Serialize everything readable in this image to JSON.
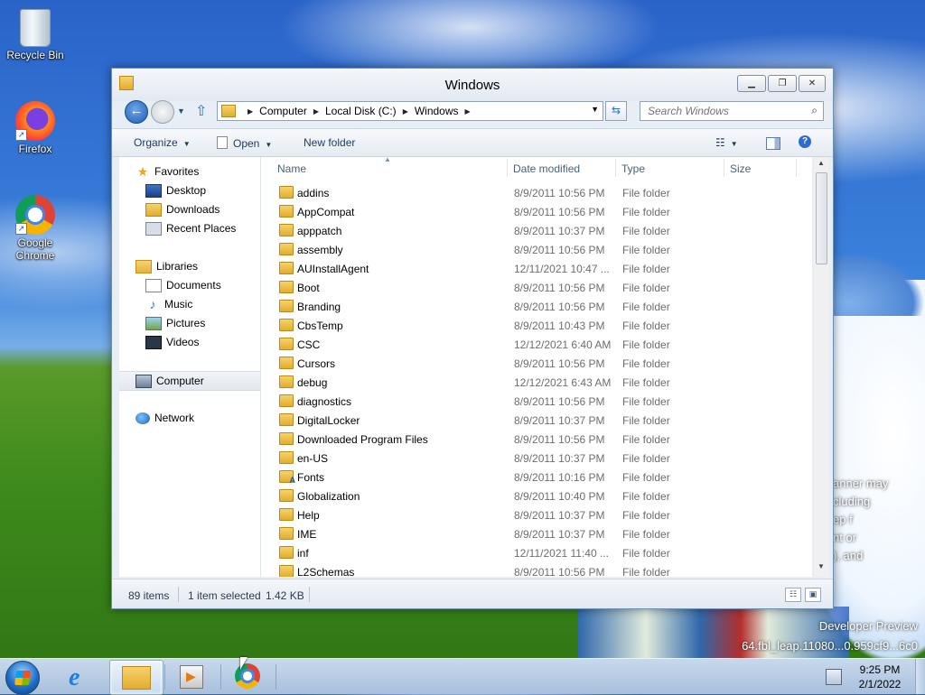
{
  "desktop": {
    "icons": [
      {
        "label": "Recycle Bin",
        "icon": "recycle-bin-icon"
      },
      {
        "label": "Firefox",
        "icon": "firefox-icon"
      },
      {
        "label": "Google Chrome",
        "icon": "chrome-icon"
      }
    ],
    "watermark_line1": "Developer Preview",
    "watermark_line2": "64.fbl_leap.11080...0.959cf9...6c0",
    "side_text": [
      "anner may",
      "cluding",
      "ep f",
      "nt or",
      "), and"
    ]
  },
  "window": {
    "title": "Windows",
    "buttons": {
      "minimize": "▁",
      "maximize": "❐",
      "close": "✕"
    },
    "address": {
      "crumbs": [
        "Computer",
        "Local Disk (C:)",
        "Windows"
      ],
      "separator": "▶"
    },
    "search": {
      "placeholder": "Search Windows"
    },
    "toolbar": {
      "organize": "Organize",
      "open": "Open",
      "new_folder": "New folder"
    },
    "nav": {
      "favorites": "Favorites",
      "desktop": "Desktop",
      "downloads": "Downloads",
      "recent_places": "Recent Places",
      "libraries": "Libraries",
      "documents": "Documents",
      "music": "Music",
      "pictures": "Pictures",
      "videos": "Videos",
      "computer": "Computer",
      "network": "Network"
    },
    "columns": {
      "name": "Name",
      "date": "Date modified",
      "type": "Type",
      "size": "Size"
    },
    "files": [
      {
        "name": "addins",
        "date": "8/9/2011 10:56 PM",
        "type": "File folder"
      },
      {
        "name": "AppCompat",
        "date": "8/9/2011 10:56 PM",
        "type": "File folder"
      },
      {
        "name": "apppatch",
        "date": "8/9/2011 10:37 PM",
        "type": "File folder"
      },
      {
        "name": "assembly",
        "date": "8/9/2011 10:56 PM",
        "type": "File folder"
      },
      {
        "name": "AUInstallAgent",
        "date": "12/11/2021 10:47 ...",
        "type": "File folder"
      },
      {
        "name": "Boot",
        "date": "8/9/2011 10:56 PM",
        "type": "File folder"
      },
      {
        "name": "Branding",
        "date": "8/9/2011 10:56 PM",
        "type": "File folder"
      },
      {
        "name": "CbsTemp",
        "date": "8/9/2011 10:43 PM",
        "type": "File folder"
      },
      {
        "name": "CSC",
        "date": "12/12/2021 6:40 AM",
        "type": "File folder"
      },
      {
        "name": "Cursors",
        "date": "8/9/2011 10:56 PM",
        "type": "File folder"
      },
      {
        "name": "debug",
        "date": "12/12/2021 6:43 AM",
        "type": "File folder"
      },
      {
        "name": "diagnostics",
        "date": "8/9/2011 10:56 PM",
        "type": "File folder"
      },
      {
        "name": "DigitalLocker",
        "date": "8/9/2011 10:37 PM",
        "type": "File folder"
      },
      {
        "name": "Downloaded Program Files",
        "date": "8/9/2011 10:56 PM",
        "type": "File folder"
      },
      {
        "name": "en-US",
        "date": "8/9/2011 10:37 PM",
        "type": "File folder"
      },
      {
        "name": "Fonts",
        "date": "8/9/2011 10:16 PM",
        "type": "File folder",
        "special": true
      },
      {
        "name": "Globalization",
        "date": "8/9/2011 10:40 PM",
        "type": "File folder"
      },
      {
        "name": "Help",
        "date": "8/9/2011 10:37 PM",
        "type": "File folder"
      },
      {
        "name": "IME",
        "date": "8/9/2011 10:37 PM",
        "type": "File folder"
      },
      {
        "name": "inf",
        "date": "12/11/2021 11:40 ...",
        "type": "File folder"
      },
      {
        "name": "L2Schemas",
        "date": "8/9/2011 10:56 PM",
        "type": "File folder"
      }
    ],
    "status": {
      "items": "89 items",
      "selected": "1 item selected",
      "size": "1.42 KB"
    }
  },
  "taskbar": {
    "apps": [
      "start-button",
      "internet-explorer",
      "windows-explorer",
      "windows-media-player",
      "google-chrome"
    ],
    "time": "9:25 PM",
    "date": "2/1/2022"
  }
}
